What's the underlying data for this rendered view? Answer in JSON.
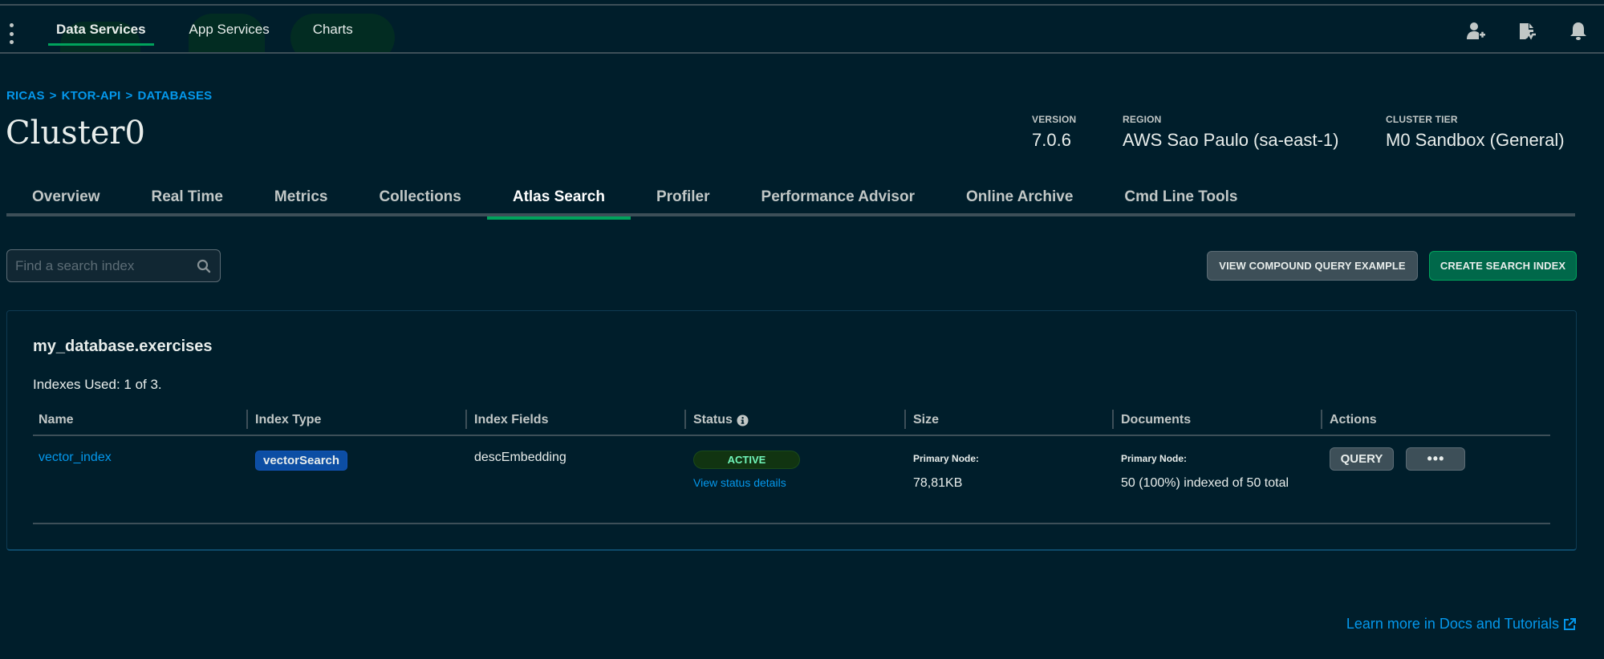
{
  "topnav": {
    "items": [
      {
        "label": "Data Services",
        "active": true
      },
      {
        "label": "App Services",
        "active": false
      },
      {
        "label": "Charts",
        "active": false
      }
    ],
    "icons": [
      "invite-user-icon",
      "activity-feed-icon",
      "notifications-bell-icon"
    ]
  },
  "breadcrumb": [
    "RICAS",
    "KTOR-API",
    "DATABASES"
  ],
  "breadcrumb_separator": ">",
  "page_title": "Cluster0",
  "cluster_meta": {
    "version": {
      "label": "VERSION",
      "value": "7.0.6"
    },
    "region": {
      "label": "REGION",
      "value": "AWS Sao Paulo (sa-east-1)"
    },
    "tier": {
      "label": "CLUSTER TIER",
      "value": "M0 Sandbox (General)"
    }
  },
  "tabs": [
    {
      "label": "Overview",
      "active": false
    },
    {
      "label": "Real Time",
      "active": false
    },
    {
      "label": "Metrics",
      "active": false
    },
    {
      "label": "Collections",
      "active": false
    },
    {
      "label": "Atlas Search",
      "active": true
    },
    {
      "label": "Profiler",
      "active": false
    },
    {
      "label": "Performance Advisor",
      "active": false
    },
    {
      "label": "Online Archive",
      "active": false
    },
    {
      "label": "Cmd Line Tools",
      "active": false
    }
  ],
  "search": {
    "placeholder": "Find a search index",
    "value": ""
  },
  "buttons": {
    "view_compound": "VIEW COMPOUND QUERY EXAMPLE",
    "create_index": "CREATE SEARCH INDEX"
  },
  "collection": {
    "title": "my_database.exercises",
    "indexes_used": "Indexes Used: 1 of 3."
  },
  "table": {
    "columns": [
      "Name",
      "Index Type",
      "Index Fields",
      "Status",
      "Size",
      "Documents",
      "Actions"
    ],
    "rows": [
      {
        "name": "vector_index",
        "index_type": "vectorSearch",
        "index_fields": "descEmbedding",
        "status": "ACTIVE",
        "status_link": "View status details",
        "size_label": "Primary Node:",
        "size_value": "78,81KB",
        "documents_label": "Primary Node:",
        "documents_value": "50 (100%) indexed of 50 total",
        "actions": {
          "query": "QUERY",
          "more": "•••"
        }
      }
    ]
  },
  "footer_link": "Learn more in Docs and Tutorials",
  "colors": {
    "background": "#001e2b",
    "accent_green": "#00a35c",
    "link_blue": "#0498ec",
    "primary_button": "#00684a",
    "secondary_button": "#3d4f58",
    "type_badge": "#0c4ea4",
    "active_badge_text": "#71f6ba"
  }
}
